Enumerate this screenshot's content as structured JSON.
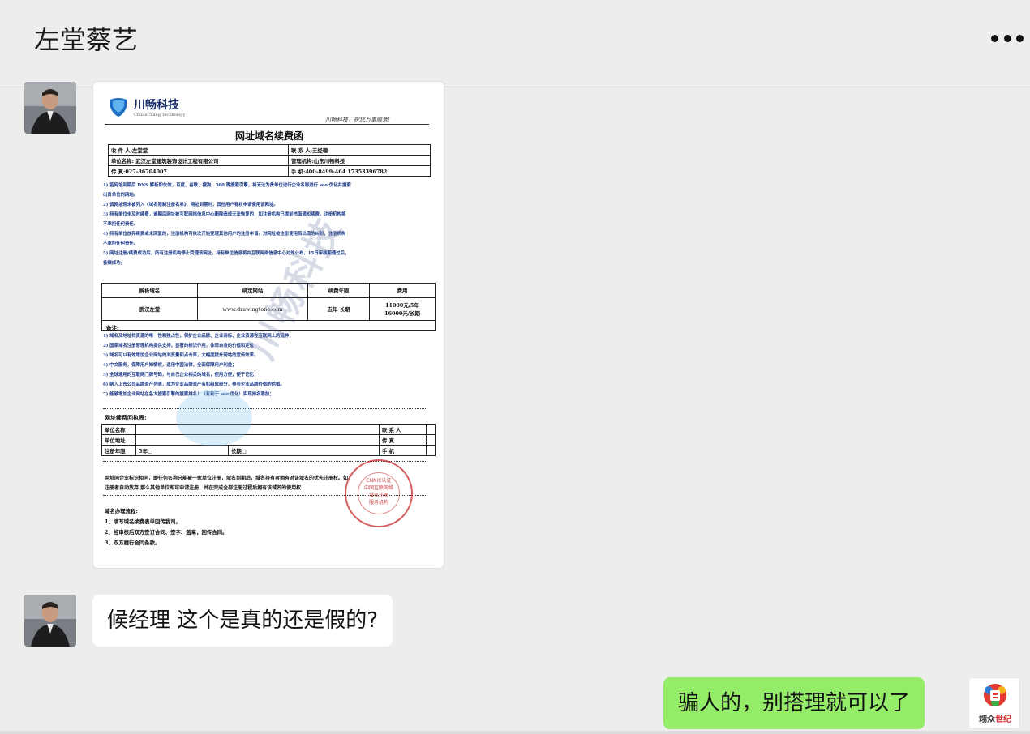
{
  "header": {
    "title": "左堂蔡艺",
    "more_icon": "more-dots-icon"
  },
  "colors": {
    "background": "#ededed",
    "self_bubble": "#95ec69",
    "other_bubble": "#ffffff"
  },
  "messages": [
    {
      "sender": "other",
      "type": "image"
    },
    {
      "sender": "other",
      "type": "text",
      "text": "候经理  这个是真的还是假的?"
    },
    {
      "sender": "self",
      "type": "text",
      "text": "骗人的，别搭理就可以了"
    }
  ],
  "document": {
    "logo_name": "川畅科技",
    "logo_sub": "ChuanChang Technology",
    "slogan": "川畅科技，祝您万事顺意!",
    "title": "网址域名续费函",
    "info": {
      "recipient": "收 件 人:左堂堂",
      "contact": "联 系 人:王经理",
      "company": "单位名称: 武汉左堂建筑装饰设计工程有限公司",
      "manager_org": "管理机构:山东川畅科技",
      "fax": "传      真:027-86704007",
      "mobile": "手     机:400-8499-464    17353396782"
    },
    "notes1": [
      "1) 若网址到期后 DNS 解析即失效，百度、谷歌、搜狗、360 等搜索引擎，将无法为贵单位进行企业名称进行 seo 优化并搜索",
      "出贵单位的网站。",
      "2) 该网址现未被列入《域名限制注册名单》，网址到期时，其他用户有权申请使用该网址。",
      "3) 持有单位未及时续费，逾期后网址被互联网络信息中心删除造成无法恢复的，如注册机构已提前书面通知续费，注册机构将",
      "不承担任何责任。",
      "4) 持有单位放弃续费或未回复的，注册机构可依次开始受理其他用户的注册申请。对网址被注册使用后出现的纠纷，注册机构",
      "不承担任何责任。",
      "5) 网址注册/续费成功后，所有注册机构停止受理该网址，持有单位信息将由互联网络信息中心对外公布，15日审核期通过后，",
      "备案成功。"
    ],
    "fee_table": {
      "headers": [
        "解析域名",
        "绑定网站",
        "续费年限",
        "费用"
      ],
      "row": [
        "武汉左堂",
        "www.drawingtone.com",
        "五年    长期",
        "11000元/5年",
        "16000元/长期"
      ]
    },
    "remarks_label": "备注:",
    "notes2": [
      "1) 域名及地址栏资源的唯一性和独占性，保护企业品牌、企业商标、企业资源在互联网上的延伸；",
      "2) 国家域名注册管理机构提供支持，显著的标识作用，体现自身的价值和定位；",
      "3) 域名可以有效增加企业网站的浏览量和点击率，大幅度提升网站的宣传效率。",
      "4) 中文服务，保障用户知情权，适用中国法律，全面保障用户利益；",
      "5) 全球通用的互联网门牌号码，与自己企业相关的域名，使用方便，便于记忆；",
      "6) 纳入上市公司品牌资产列表，成为企业品牌资产有机组成部分，参与企业品牌价值的估值。",
      "7) 能够增加企业网站在各大搜索引擎的搜索排名！（有利于 seo 优化）实现排名靠前；"
    ],
    "receipt_title": "网址续费回执表:",
    "receipt": {
      "company": "单位名称",
      "address": "单位地址",
      "years": "注册年限",
      "five_years": "5年□",
      "long_term": "长期□",
      "contact": "联  系  人",
      "fax": "传      真",
      "mobile": "手      机"
    },
    "bottom_text": [
      "网址同企业标识相同，即任何名称只能被一家单位注册，域名到期后，域名持有者拥有对该域名的优先注册权。如",
      "注册者自动放弃,那么其他单位即可申请注册，并在完成全部注册过程后拥有该域名的使用权"
    ],
    "process_title": "域名办理流程:",
    "process": [
      "1、填写域名续费表单回传我司。",
      "2、经审核后双方签订合同、签字、盖章，回传合同。",
      "3、双方履行合同条款。"
    ],
    "seal_text": [
      "CNNIC认证",
      "中国互联网络",
      "域名注册",
      "服务机构"
    ]
  },
  "brand_avatar": {
    "name_a": "翊众",
    "name_b": "世纪"
  }
}
